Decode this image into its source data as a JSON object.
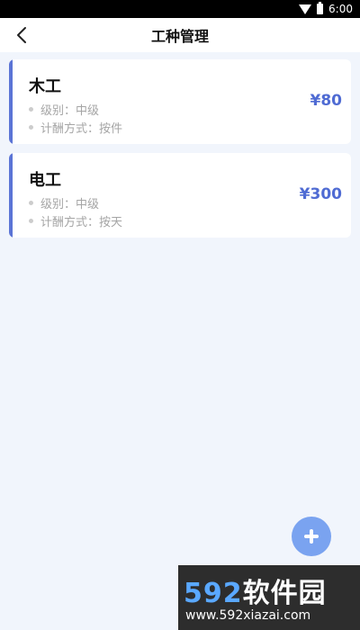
{
  "status_bar": {
    "time": "6:00"
  },
  "header": {
    "title": "工种管理"
  },
  "cards": [
    {
      "name": "木工",
      "level": "级别：中级",
      "pay_method": "计酬方式：按件",
      "price": "¥80"
    },
    {
      "name": "电工",
      "level": "级别：中级",
      "pay_method": "计酬方式：按天",
      "price": "¥300"
    }
  ],
  "fab": {
    "icon": "plus-icon"
  },
  "watermark": {
    "brand_num": "592",
    "brand_text": "软件园",
    "url": "www.592xiazai.com"
  },
  "colors": {
    "accent": "#5b74d6",
    "price": "#4f6bd3",
    "fab": "#7aa3f0",
    "background": "#f1f5fc"
  }
}
